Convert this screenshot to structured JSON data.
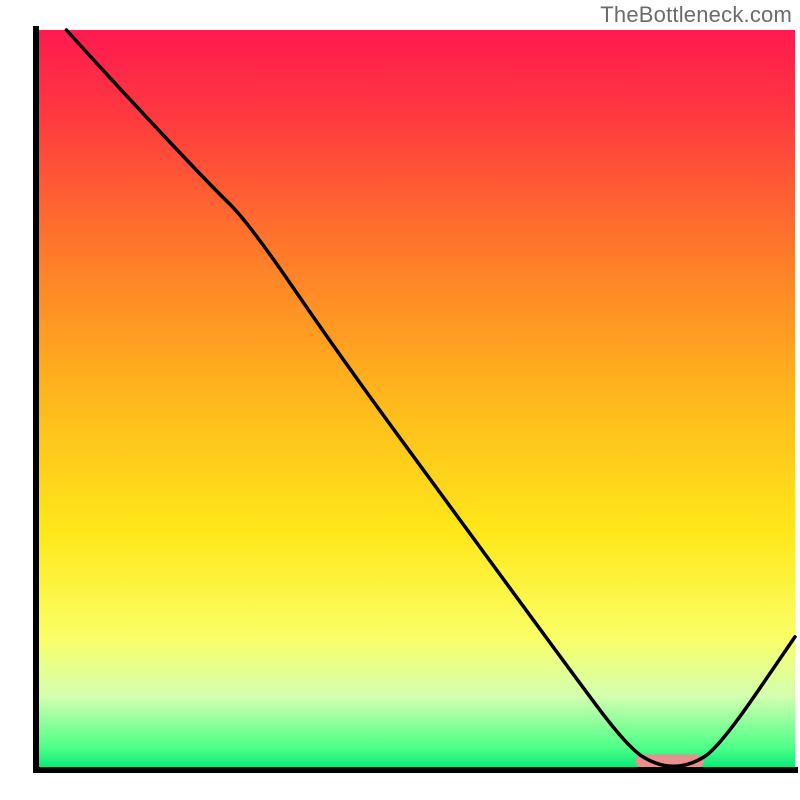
{
  "watermark": "TheBottleneck.com",
  "chart_data": {
    "type": "line",
    "title": "",
    "xlabel": "",
    "ylabel": "",
    "xlim": [
      0,
      100
    ],
    "ylim": [
      0,
      100
    ],
    "grid": false,
    "legend": false,
    "gradient": {
      "type": "vertical",
      "stops": [
        {
          "offset": 0.0,
          "color": "#ff1a4f"
        },
        {
          "offset": 0.12,
          "color": "#ff3a3f"
        },
        {
          "offset": 0.3,
          "color": "#ff7a2a"
        },
        {
          "offset": 0.5,
          "color": "#ffb81c"
        },
        {
          "offset": 0.68,
          "color": "#ffe81a"
        },
        {
          "offset": 0.82,
          "color": "#faff66"
        },
        {
          "offset": 0.9,
          "color": "#d4ffb0"
        },
        {
          "offset": 0.97,
          "color": "#4dff88"
        },
        {
          "offset": 1.0,
          "color": "#00e676"
        }
      ]
    },
    "axes": {
      "color": "#000000",
      "width": 6
    },
    "series": [
      {
        "name": "bottleneck-curve",
        "color": "#000000",
        "width": 3.5,
        "x": [
          4,
          12,
          23,
          28,
          40,
          55,
          70,
          78,
          82,
          86,
          90,
          100
        ],
        "y": [
          100,
          91,
          79,
          74,
          56,
          35,
          14,
          3,
          0.5,
          0.5,
          3,
          18
        ]
      }
    ],
    "marker": {
      "name": "optimal-range",
      "shape": "rounded-bar",
      "color": "#e88f8f",
      "x_start": 79,
      "x_end": 88,
      "y": 1.2,
      "height_frac": 0.018
    }
  }
}
